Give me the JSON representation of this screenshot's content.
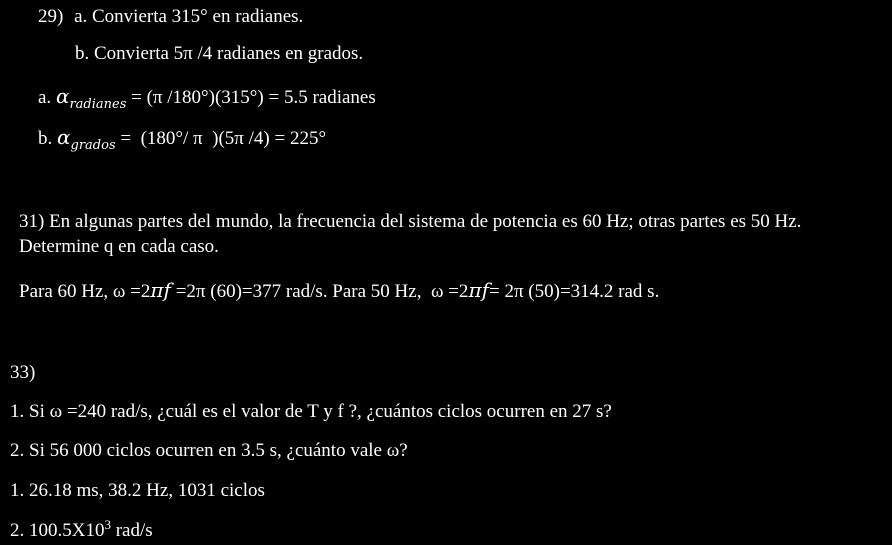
{
  "problem29": {
    "number": "29)",
    "part_a_question": "a. Convierta 315° en radianes.",
    "part_b_question": "b. Convierta 5π /4 radianes en grados.",
    "answer_a": {
      "prefix": "a.",
      "symbol": "α",
      "subscript": "radianes",
      "expression": " = (π /180°)(315°) = 5.5 radianes"
    },
    "answer_b": {
      "prefix": "b.",
      "symbol": "α",
      "subscript": "grados",
      "expression": " =  (180°/ π  )(5π /4) = 225°"
    }
  },
  "problem31": {
    "statement_line1": "31) En algunas partes del mundo, la frecuencia del sistema de potencia es 60 Hz; otras partes es 50 Hz.",
    "statement_line2": "Determine q en cada caso.",
    "answer_p1": "Para 60 Hz, ω =2",
    "answer_f1": "πf",
    "answer_p2": " =2π (60)=377 rad/s. Para 50 Hz,  ω =2",
    "answer_f2": "πf",
    "answer_p3": "= 2π (50)=314.2 rad s."
  },
  "problem33": {
    "number": "33)",
    "question1": "1. Si ω =240 rad/s, ¿cuál es el valor de T y f ?, ¿cuántos ciclos ocurren en 27 s?",
    "question2": "2. Si 56 000 ciclos ocurren en 3.5 s, ¿cuánto vale ω?",
    "answer1": "1. 26.18 ms, 38.2 Hz, 1031 ciclos",
    "answer2_base": "2. 100.5X10",
    "answer2_exp": "3",
    "answer2_unit": " rad/s"
  }
}
